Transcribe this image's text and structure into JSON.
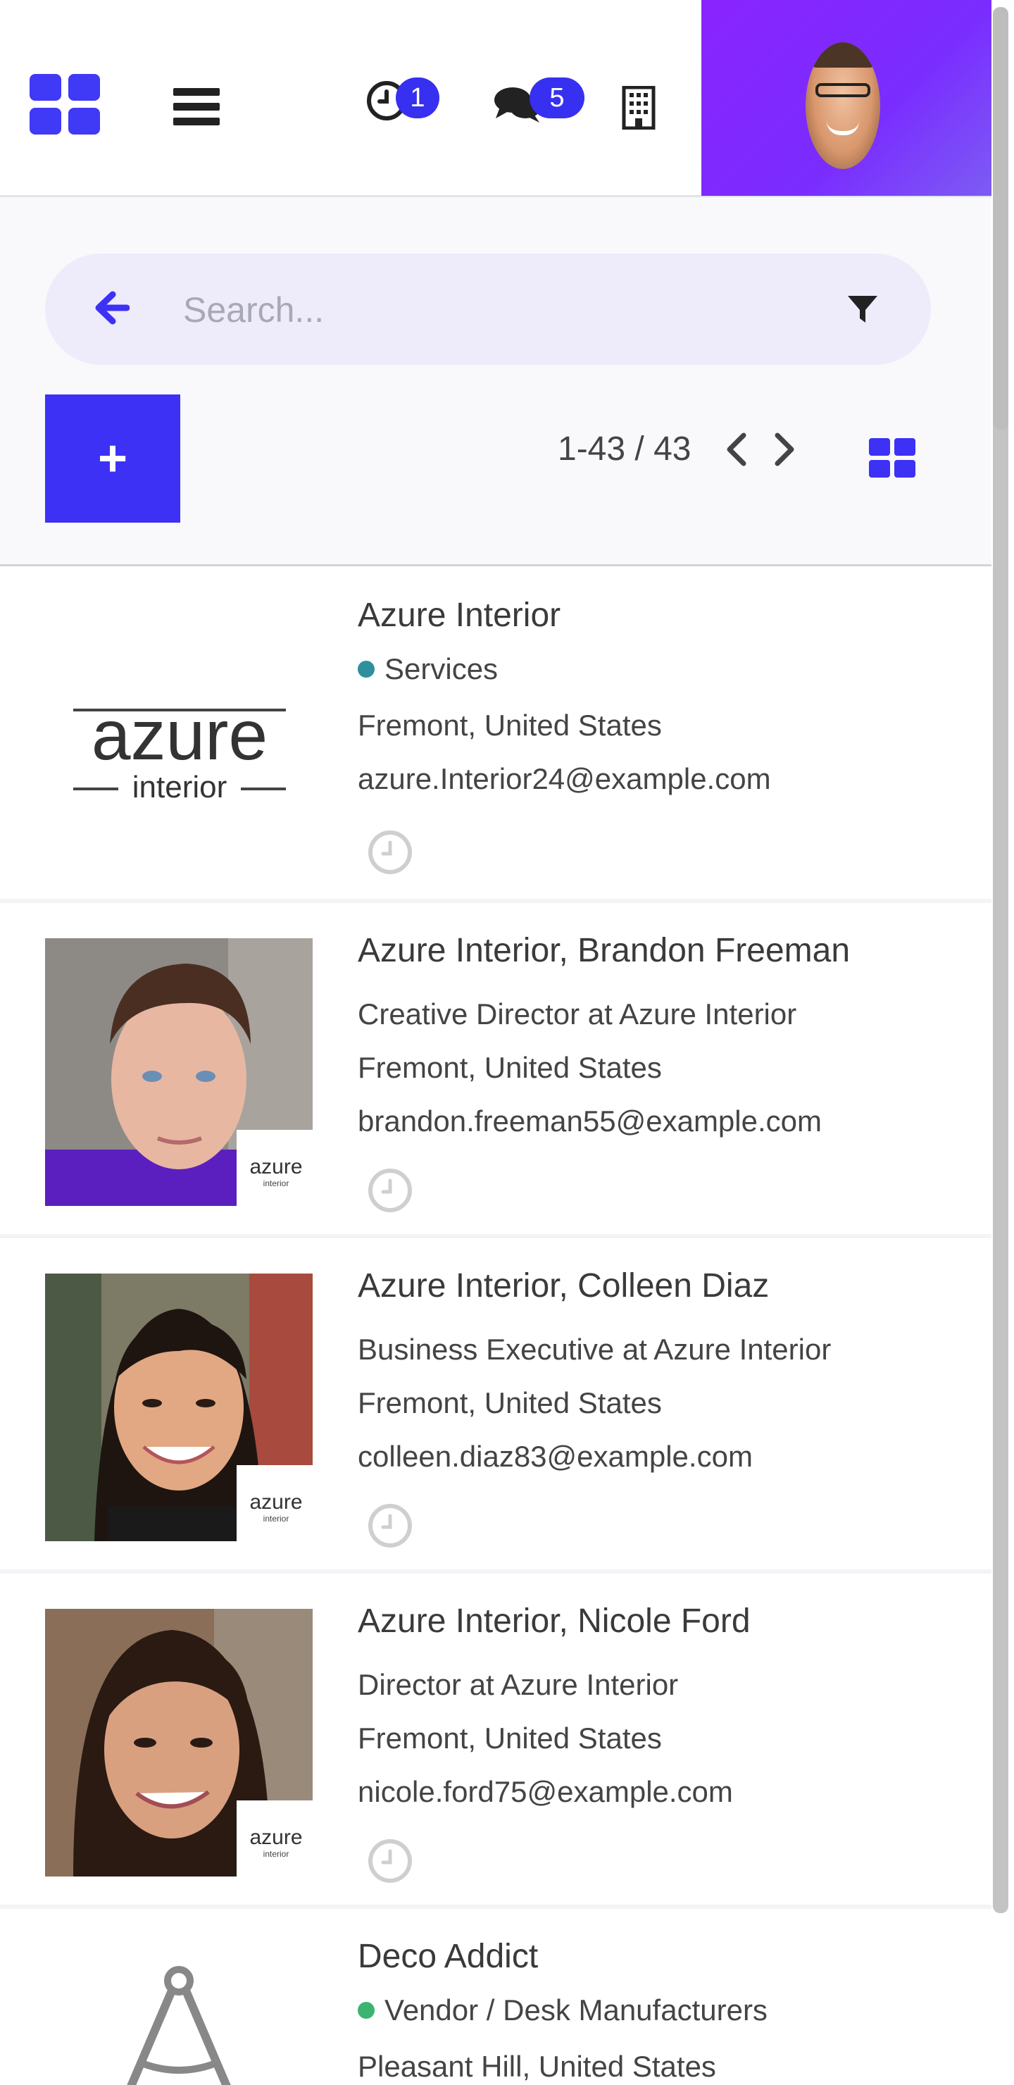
{
  "navbar": {
    "activity_count": "1",
    "messages_count": "5",
    "brand_color": "#4039f5",
    "user_panel_color": "#8a24ff"
  },
  "search": {
    "placeholder": "Search..."
  },
  "control_panel": {
    "create_label": "+",
    "pager": "1-43 / 43"
  },
  "icons": {
    "apps": "apps-grid-icon",
    "menu": "hamburger-menu-icon",
    "activity": "clock-icon",
    "messages": "chat-bubbles-icon",
    "company": "building-icon",
    "back": "arrow-left-icon",
    "filter": "filter-icon",
    "prev": "chevron-left-icon",
    "next": "chevron-right-icon",
    "view": "kanban-grid-icon"
  },
  "records": [
    {
      "name": "Azure Interior",
      "tag": "Services",
      "tag_color": "#2e8f9e",
      "city": "Fremont, United States",
      "email": "azure.Interior24@example.com"
    },
    {
      "name": "Azure Interior, Brandon Freeman",
      "title": "Creative Director at Azure Interior",
      "city": "Fremont, United States",
      "email": "brandon.freeman55@example.com"
    },
    {
      "name": "Azure Interior, Colleen Diaz",
      "title": "Business Executive at Azure Interior",
      "city": "Fremont, United States",
      "email": "colleen.diaz83@example.com"
    },
    {
      "name": "Azure Interior, Nicole Ford",
      "title": "Director at Azure Interior",
      "city": "Fremont, United States",
      "email": "nicole.ford75@example.com"
    },
    {
      "name": "Deco Addict",
      "tag": "Vendor / Desk Manufacturers",
      "tag_color": "#3cb371",
      "city": "Pleasant Hill, United States"
    }
  ],
  "logos": {
    "azure_word": "azure",
    "azure_sub": "interior"
  }
}
